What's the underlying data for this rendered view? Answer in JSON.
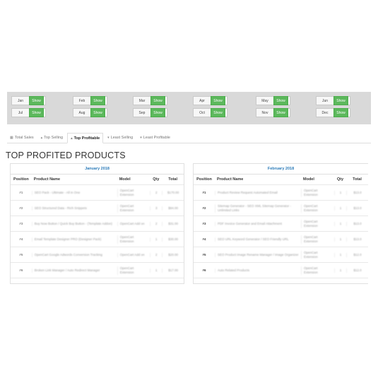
{
  "months": [
    {
      "label": "Jan",
      "button": "Show"
    },
    {
      "label": "Feb",
      "button": "Show"
    },
    {
      "label": "Mar",
      "button": "Show"
    },
    {
      "label": "Apr",
      "button": "Show"
    },
    {
      "label": "May",
      "button": "Show"
    },
    {
      "label": "Jun",
      "button": "Show"
    },
    {
      "label": "Jul",
      "button": "Show"
    },
    {
      "label": "Aug",
      "button": "Show"
    },
    {
      "label": "Sep",
      "button": "Show"
    },
    {
      "label": "Oct",
      "button": "Show"
    },
    {
      "label": "Nov",
      "button": "Show"
    },
    {
      "label": "Dec",
      "button": "Show"
    }
  ],
  "tabs": [
    {
      "label": "Total Sales",
      "icon": "bar-chart-icon"
    },
    {
      "label": "Top Selling",
      "icon": "arrow-up-icon"
    },
    {
      "label": "Top Profitable",
      "icon": "arrow-up-icon",
      "active": true
    },
    {
      "label": "Least Selling",
      "icon": "arrow-down-icon"
    },
    {
      "label": "Least Profitable",
      "icon": "arrow-down-icon"
    }
  ],
  "heading": "TOP PROFITED PRODUCTS",
  "columns": {
    "position": "Position",
    "name": "Product Name",
    "model": "Model",
    "qty": "Qty",
    "total": "Total"
  },
  "tables": [
    {
      "title": "January 2018",
      "rows": [
        {
          "pos": "#1",
          "name": "SEO Pack - Ultimate - All in One",
          "model": "OpenCart Extension",
          "qty": "2",
          "total": "$170.00"
        },
        {
          "pos": "#2",
          "name": "SEO Structured Data - Rich Snippets",
          "model": "OpenCart Extension",
          "qty": "3",
          "total": "$84.00"
        },
        {
          "pos": "#3",
          "name": "Buy Now Button / Quick Buy Button - (Template Addon)",
          "model": "OpenCart Add on",
          "qty": "2",
          "total": "$31.00"
        },
        {
          "pos": "#4",
          "name": "Email Template Designer PRO (Designer Pack)",
          "model": "OpenCart Extension",
          "qty": "1",
          "total": "$30.00"
        },
        {
          "pos": "#5",
          "name": "OpenCart Google Adwords Conversion Tracking",
          "model": "OpenCart Add on",
          "qty": "2",
          "total": "$20.00"
        },
        {
          "pos": "#6",
          "name": "Broken Link Manager / Auto Redirect Manager",
          "model": "OpenCart Extension",
          "qty": "1",
          "total": "$17.00"
        }
      ]
    },
    {
      "title": "February 2018",
      "rows": [
        {
          "pos": "#1",
          "name": "Product Review Request Automated Email",
          "model": "OpenCart Extension",
          "qty": "1",
          "total": "$13.0"
        },
        {
          "pos": "#2",
          "name": "Sitemap Generator - SEO XML Sitemap Generator - Unlimited Links",
          "model": "OpenCart Extension",
          "qty": "1",
          "total": "$13.0"
        },
        {
          "pos": "#3",
          "name": "PDF Invoice Generator and Email Attachment",
          "model": "OpenCart Extension",
          "qty": "1",
          "total": "$13.0"
        },
        {
          "pos": "#4",
          "name": "SEO URL Keyword Generator / SEO Friendly URL",
          "model": "OpenCart Extension",
          "qty": "1",
          "total": "$13.0"
        },
        {
          "pos": "#5",
          "name": "SEO Product Image Rename Manager / Image Organizer",
          "model": "OpenCart Extension",
          "qty": "1",
          "total": "$12.0"
        },
        {
          "pos": "#6",
          "name": "Auto Related Products",
          "model": "OpenCart Extension",
          "qty": "1",
          "total": "$12.0"
        }
      ]
    }
  ]
}
